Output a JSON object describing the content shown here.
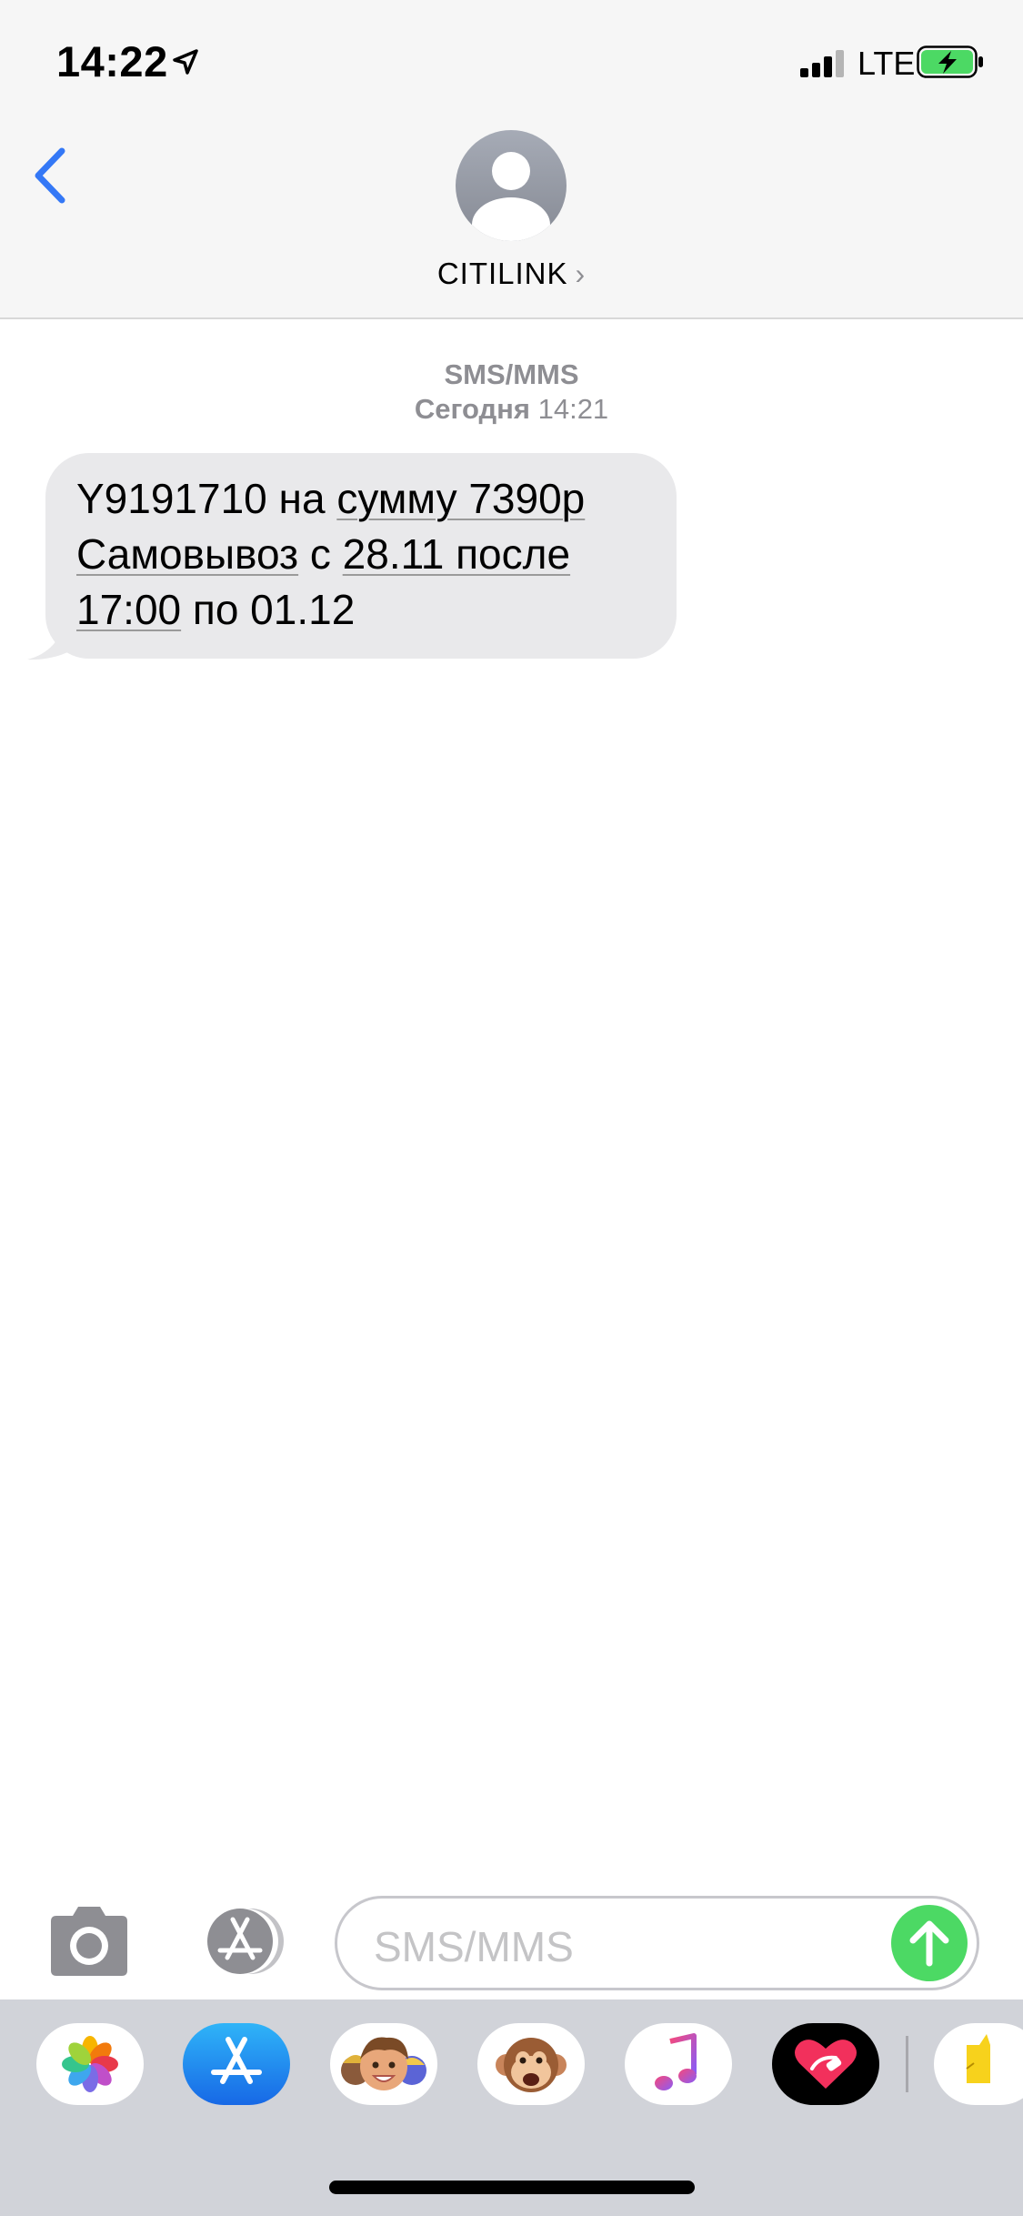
{
  "status_bar": {
    "time": "14:22",
    "network": "LTE"
  },
  "nav": {
    "contact_name": "CITILINK",
    "chevron": "›"
  },
  "conversation": {
    "service_label": "SMS/MMS",
    "day_label": "Сегодня",
    "time_label": "14:21",
    "message": {
      "l1_a": "Y9191710 на ",
      "l1_b": "сумму 7390р",
      "l2_a": "Самовывоз",
      "l2_b": " с ",
      "l2_c": "28.11 после",
      "l3_a": "17:00",
      "l3_b": " по 01.12"
    }
  },
  "composer": {
    "placeholder": "SMS/MMS"
  },
  "icons": {
    "back": "chevron-left-icon",
    "avatar": "person-icon",
    "camera": "camera-icon",
    "appstore": "app-store-icon",
    "send": "arrow-up-icon",
    "accent": "#3478f6",
    "send_color": "#4cd964",
    "battery_color": "#4cd964"
  },
  "app_drawer": {
    "apps": [
      "photos-icon",
      "app-store-icon",
      "memoji-icon",
      "animoji-monkey-icon",
      "music-icon",
      "digital-touch-icon",
      "sticker-app-icon"
    ]
  }
}
